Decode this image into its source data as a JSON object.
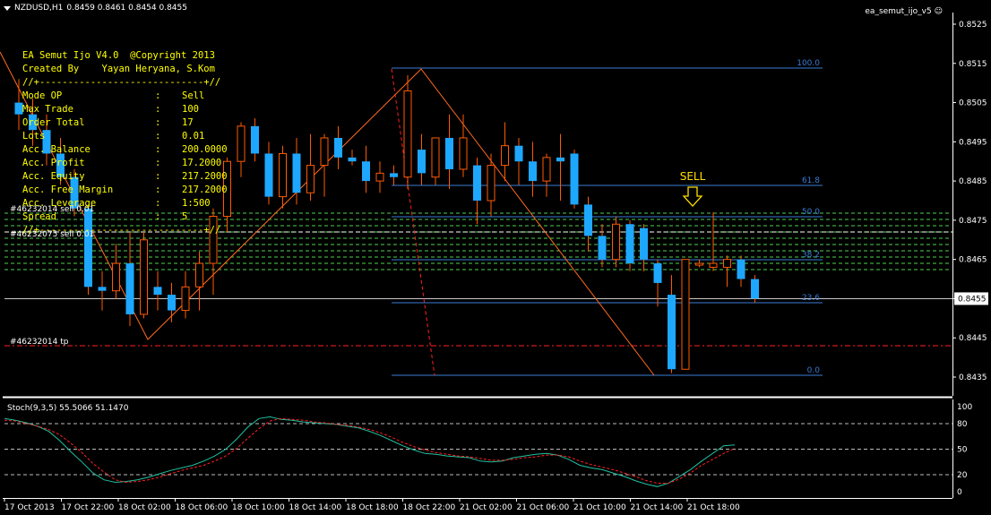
{
  "header": {
    "symbol": "NZDUSD,H1",
    "ohlc": "0.8459 0.8461 0.8454 0.8455",
    "ea_name": "ea_semut_ijo_v5",
    "smiley": "☺"
  },
  "info_panel": {
    "title_lines": [
      "EA Semut Ijo V4.0  @Copyright 2013",
      "Created By    Yayan Heryana, S.Kom",
      "//+-----------------------------+//"
    ],
    "rows": [
      {
        "label": "Mode OP",
        "value": "Sell"
      },
      {
        "label": "Max Trade",
        "value": "100"
      },
      {
        "label": "Order Total",
        "value": "17"
      },
      {
        "label": "Lots",
        "value": "0.01"
      },
      {
        "label": "Acc. Balance",
        "value": "200.0000"
      },
      {
        "label": "Acc. Profit",
        "value": "17.2000"
      },
      {
        "label": "Acc. Equity",
        "value": "217.2000"
      },
      {
        "label": "Acc. Free Margin",
        "value": "217.2000"
      },
      {
        "label": "Acc. Leverage",
        "value": "1:500"
      },
      {
        "label": "Spread",
        "value": "5"
      }
    ],
    "footer_line": "//+-----------------------------+//"
  },
  "order_labels": [
    "#46232014 sell 0.01",
    "#46232075 sell 0.01",
    "#46232014 tp"
  ],
  "sell_label": "SELL",
  "fib_levels": [
    "100.0",
    "61.8",
    "50.0",
    "38.2",
    "23.6",
    "0.0"
  ],
  "price_axis": [
    "0.8525",
    "0.8515",
    "0.8505",
    "0.8495",
    "0.8485",
    "0.8475",
    "0.8465",
    "0.8455",
    "0.8445",
    "0.8435"
  ],
  "current_price": "0.8455",
  "stoch_label": "Stoch(9,3,5) 55.5066 51.1470",
  "stoch_axis": [
    "100",
    "80",
    "50",
    "20",
    "0"
  ],
  "time_axis": [
    "17 Oct 2013",
    "17 Oct 22:00",
    "18 Oct 02:00",
    "18 Oct 06:00",
    "18 Oct 10:00",
    "18 Oct 14:00",
    "18 Oct 18:00",
    "18 Oct 22:00",
    "21 Oct 02:00",
    "21 Oct 06:00",
    "21 Oct 10:00",
    "21 Oct 14:00",
    "21 Oct 18:00"
  ],
  "colors": {
    "bull": "#1ea7ff",
    "bear": "#000000",
    "bear_outline": "#ff5a00",
    "wick": "#ff5a00",
    "fib": "#3a7bd5",
    "grid_green": "#4fd14f",
    "tp": "#ff2020",
    "stoch_main": "#20c0a0",
    "stoch_signal": "#ff2020",
    "zigzag": "#ff6a20",
    "sell": "#ffe000"
  },
  "chart_data": {
    "type": "candlestick",
    "symbol": "NZDUSD",
    "timeframe": "H1",
    "ylim": [
      0.8431,
      0.8531
    ],
    "candles": [
      {
        "o": 0.8505,
        "h": 0.8511,
        "l": 0.8498,
        "c": 0.8502
      },
      {
        "o": 0.8502,
        "h": 0.8506,
        "l": 0.8494,
        "c": 0.8498
      },
      {
        "o": 0.8498,
        "h": 0.8502,
        "l": 0.8489,
        "c": 0.8492
      },
      {
        "o": 0.8492,
        "h": 0.8496,
        "l": 0.8484,
        "c": 0.8486
      },
      {
        "o": 0.8486,
        "h": 0.8488,
        "l": 0.8476,
        "c": 0.8478
      },
      {
        "o": 0.8478,
        "h": 0.8479,
        "l": 0.8456,
        "c": 0.8458
      },
      {
        "o": 0.8458,
        "h": 0.8462,
        "l": 0.8452,
        "c": 0.8457
      },
      {
        "o": 0.8457,
        "h": 0.8469,
        "l": 0.8455,
        "c": 0.8464
      },
      {
        "o": 0.8464,
        "h": 0.8472,
        "l": 0.8448,
        "c": 0.8451
      },
      {
        "o": 0.8451,
        "h": 0.8472,
        "l": 0.845,
        "c": 0.847
      },
      {
        "o": 0.8458,
        "h": 0.8462,
        "l": 0.8452,
        "c": 0.8456
      },
      {
        "o": 0.8456,
        "h": 0.8459,
        "l": 0.8449,
        "c": 0.8452
      },
      {
        "o": 0.8452,
        "h": 0.8462,
        "l": 0.845,
        "c": 0.8458
      },
      {
        "o": 0.8458,
        "h": 0.8467,
        "l": 0.8452,
        "c": 0.8464
      },
      {
        "o": 0.8464,
        "h": 0.8478,
        "l": 0.8456,
        "c": 0.8476
      },
      {
        "o": 0.8476,
        "h": 0.8491,
        "l": 0.8472,
        "c": 0.849
      },
      {
        "o": 0.849,
        "h": 0.85,
        "l": 0.8486,
        "c": 0.8499
      },
      {
        "o": 0.8499,
        "h": 0.8501,
        "l": 0.849,
        "c": 0.8492
      },
      {
        "o": 0.8492,
        "h": 0.8495,
        "l": 0.8479,
        "c": 0.8481
      },
      {
        "o": 0.8481,
        "h": 0.8494,
        "l": 0.8478,
        "c": 0.8492
      },
      {
        "o": 0.8492,
        "h": 0.8496,
        "l": 0.8479,
        "c": 0.8482
      },
      {
        "o": 0.8482,
        "h": 0.8497,
        "l": 0.848,
        "c": 0.8489
      },
      {
        "o": 0.8489,
        "h": 0.8497,
        "l": 0.8481,
        "c": 0.8496
      },
      {
        "o": 0.8496,
        "h": 0.8499,
        "l": 0.8488,
        "c": 0.8491
      },
      {
        "o": 0.8491,
        "h": 0.8493,
        "l": 0.8489,
        "c": 0.849
      },
      {
        "o": 0.849,
        "h": 0.8494,
        "l": 0.8482,
        "c": 0.8485
      },
      {
        "o": 0.8485,
        "h": 0.849,
        "l": 0.8482,
        "c": 0.8487
      },
      {
        "o": 0.8487,
        "h": 0.8489,
        "l": 0.8484,
        "c": 0.8486
      },
      {
        "o": 0.8486,
        "h": 0.8512,
        "l": 0.8483,
        "c": 0.8508
      },
      {
        "o": 0.8493,
        "h": 0.8497,
        "l": 0.8484,
        "c": 0.8487
      },
      {
        "o": 0.8486,
        "h": 0.8496,
        "l": 0.8484,
        "c": 0.8496
      },
      {
        "o": 0.8496,
        "h": 0.8502,
        "l": 0.8483,
        "c": 0.8488
      },
      {
        "o": 0.8488,
        "h": 0.8502,
        "l": 0.8486,
        "c": 0.8496
      },
      {
        "o": 0.8489,
        "h": 0.8491,
        "l": 0.8474,
        "c": 0.848
      },
      {
        "o": 0.848,
        "h": 0.8492,
        "l": 0.8476,
        "c": 0.8489
      },
      {
        "o": 0.8489,
        "h": 0.85,
        "l": 0.8485,
        "c": 0.8494
      },
      {
        "o": 0.8494,
        "h": 0.8496,
        "l": 0.8484,
        "c": 0.849
      },
      {
        "o": 0.849,
        "h": 0.8495,
        "l": 0.8481,
        "c": 0.8485
      },
      {
        "o": 0.8485,
        "h": 0.8492,
        "l": 0.8481,
        "c": 0.8491
      },
      {
        "o": 0.8491,
        "h": 0.8497,
        "l": 0.848,
        "c": 0.849
      },
      {
        "o": 0.8492,
        "h": 0.8493,
        "l": 0.8478,
        "c": 0.8479
      },
      {
        "o": 0.8479,
        "h": 0.8481,
        "l": 0.8467,
        "c": 0.8471
      },
      {
        "o": 0.8471,
        "h": 0.8474,
        "l": 0.8463,
        "c": 0.8465
      },
      {
        "o": 0.8465,
        "h": 0.8476,
        "l": 0.8463,
        "c": 0.8474
      },
      {
        "o": 0.8474,
        "h": 0.8475,
        "l": 0.8462,
        "c": 0.8464
      },
      {
        "o": 0.8473,
        "h": 0.8474,
        "l": 0.8462,
        "c": 0.8465
      },
      {
        "o": 0.8464,
        "h": 0.8465,
        "l": 0.8453,
        "c": 0.8459
      },
      {
        "o": 0.8456,
        "h": 0.8461,
        "l": 0.8436,
        "c": 0.8437
      },
      {
        "o": 0.8437,
        "h": 0.8465,
        "l": 0.8437,
        "c": 0.8465
      },
      {
        "o": 0.8464,
        "h": 0.8465,
        "l": 0.8463,
        "c": 0.8464
      },
      {
        "o": 0.8463,
        "h": 0.8477,
        "l": 0.8462,
        "c": 0.8464
      },
      {
        "o": 0.8463,
        "h": 0.8466,
        "l": 0.8458,
        "c": 0.8465
      },
      {
        "o": 0.8465,
        "h": 0.8466,
        "l": 0.8458,
        "c": 0.846
      },
      {
        "o": 0.846,
        "h": 0.8461,
        "l": 0.8454,
        "c": 0.8455
      }
    ],
    "stochastic": {
      "params": "9,3,5",
      "main": [
        86,
        84,
        81,
        77,
        71,
        60,
        47,
        35,
        22,
        14,
        11,
        12,
        14,
        17,
        21,
        25,
        28,
        31,
        36,
        42,
        50,
        62,
        76,
        86,
        88,
        85,
        84,
        82,
        81,
        80,
        79,
        77,
        75,
        71,
        66,
        60,
        54,
        49,
        45,
        44,
        42,
        41,
        40,
        36,
        35,
        36,
        40,
        42,
        44,
        45,
        43,
        38,
        31,
        28,
        26,
        22,
        18,
        13,
        9,
        6,
        10,
        18,
        26,
        36,
        45,
        54,
        55
      ],
      "signal": [
        84,
        83,
        80,
        77,
        73,
        67,
        57,
        46,
        33,
        23,
        14,
        11,
        12,
        14,
        17,
        21,
        25,
        28,
        31,
        36,
        42,
        51,
        63,
        74,
        83,
        86,
        85,
        84,
        82,
        81,
        79,
        78,
        76,
        73,
        69,
        64,
        58,
        53,
        49,
        46,
        44,
        42,
        41,
        39,
        37,
        37,
        38,
        40,
        41,
        43,
        43,
        41,
        36,
        32,
        29,
        26,
        22,
        18,
        13,
        10,
        10,
        15,
        22,
        31,
        38,
        45,
        51
      ]
    }
  }
}
